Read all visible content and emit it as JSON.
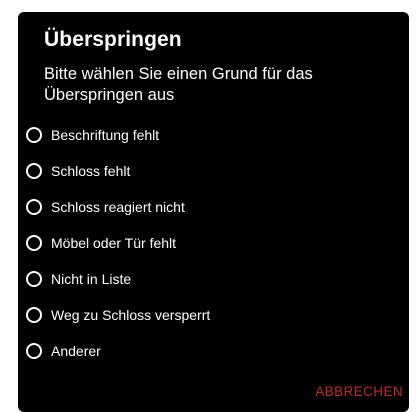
{
  "dialog": {
    "title": "Überspringen",
    "message": "Bitte wählen Sie einen Grund für das Überspringen aus",
    "options": [
      {
        "label": "Beschriftung fehlt",
        "selected": false
      },
      {
        "label": "Schloss fehlt",
        "selected": false
      },
      {
        "label": "Schloss reagiert nicht",
        "selected": false
      },
      {
        "label": "Möbel oder Tür fehlt",
        "selected": false
      },
      {
        "label": "Nicht in Liste",
        "selected": false
      },
      {
        "label": "Weg zu Schloss versperrt",
        "selected": false
      },
      {
        "label": "Anderer",
        "selected": false
      }
    ],
    "cancel_label": "ABBRECHEN"
  },
  "colors": {
    "dialog_background": "#000000",
    "text": "#ffffff",
    "accent": "#c62828"
  }
}
